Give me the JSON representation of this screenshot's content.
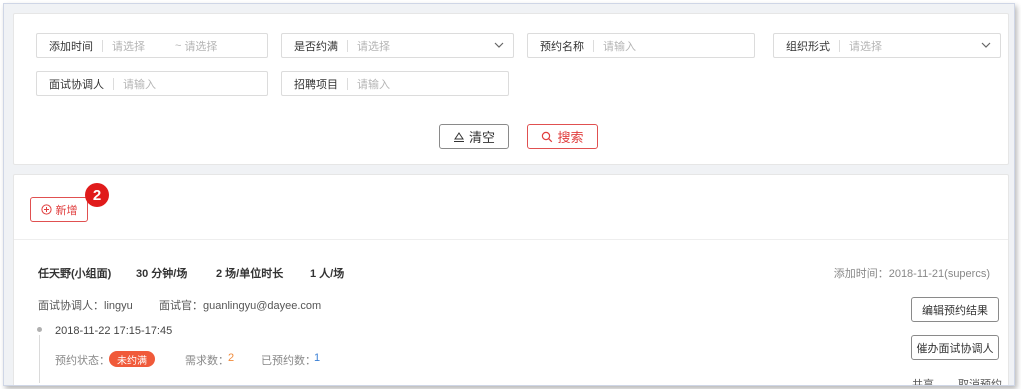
{
  "filters": {
    "add_time": {
      "label": "添加时间",
      "start_placeholder": "请选择",
      "tilde": "~",
      "end_placeholder": "请选择"
    },
    "is_full": {
      "label": "是否约满",
      "placeholder": "请选择"
    },
    "booking_name": {
      "label": "预约名称",
      "placeholder": "请输入"
    },
    "org_form": {
      "label": "组织形式",
      "placeholder": "请选择"
    },
    "coordinator": {
      "label": "面试协调人",
      "placeholder": "请输入"
    },
    "recruit_project": {
      "label": "招聘项目",
      "placeholder": "请输入"
    },
    "clear_label": "清空",
    "search_label": "搜索"
  },
  "toolbar": {
    "add_label": "新增",
    "badge": "2"
  },
  "record": {
    "name": "任天野(小组面)",
    "duration": "30 分钟/场",
    "sessions": "2 场/单位时长",
    "people": "1 人/场",
    "added": "添加时间：2018-11-21(supercs)",
    "coordinator": "面试协调人：lingyu",
    "interviewer": "面试官：guanlingyu@dayee.com",
    "time_slot": "2018-11-22 17:15-17:45",
    "status_label": "预约状态：",
    "status_value": "未约满",
    "demand_label": "需求数：",
    "demand_value": "2",
    "booked_label": "已预约数：",
    "booked_value": "1",
    "edit_button": "编辑预约结果",
    "remind_button": "催办面试协调人",
    "share_link": "共享",
    "cancel_link": "取消预约"
  },
  "colors": {
    "accent": "#e03e3e",
    "status_bg": "#f05a3a",
    "demand": "#f08a3a",
    "booked": "#3a7fd5"
  },
  "icons": {
    "clear": "eraser-icon",
    "search": "search-icon",
    "add": "plus-circle-icon",
    "dropdown": "chevron-down-icon"
  }
}
